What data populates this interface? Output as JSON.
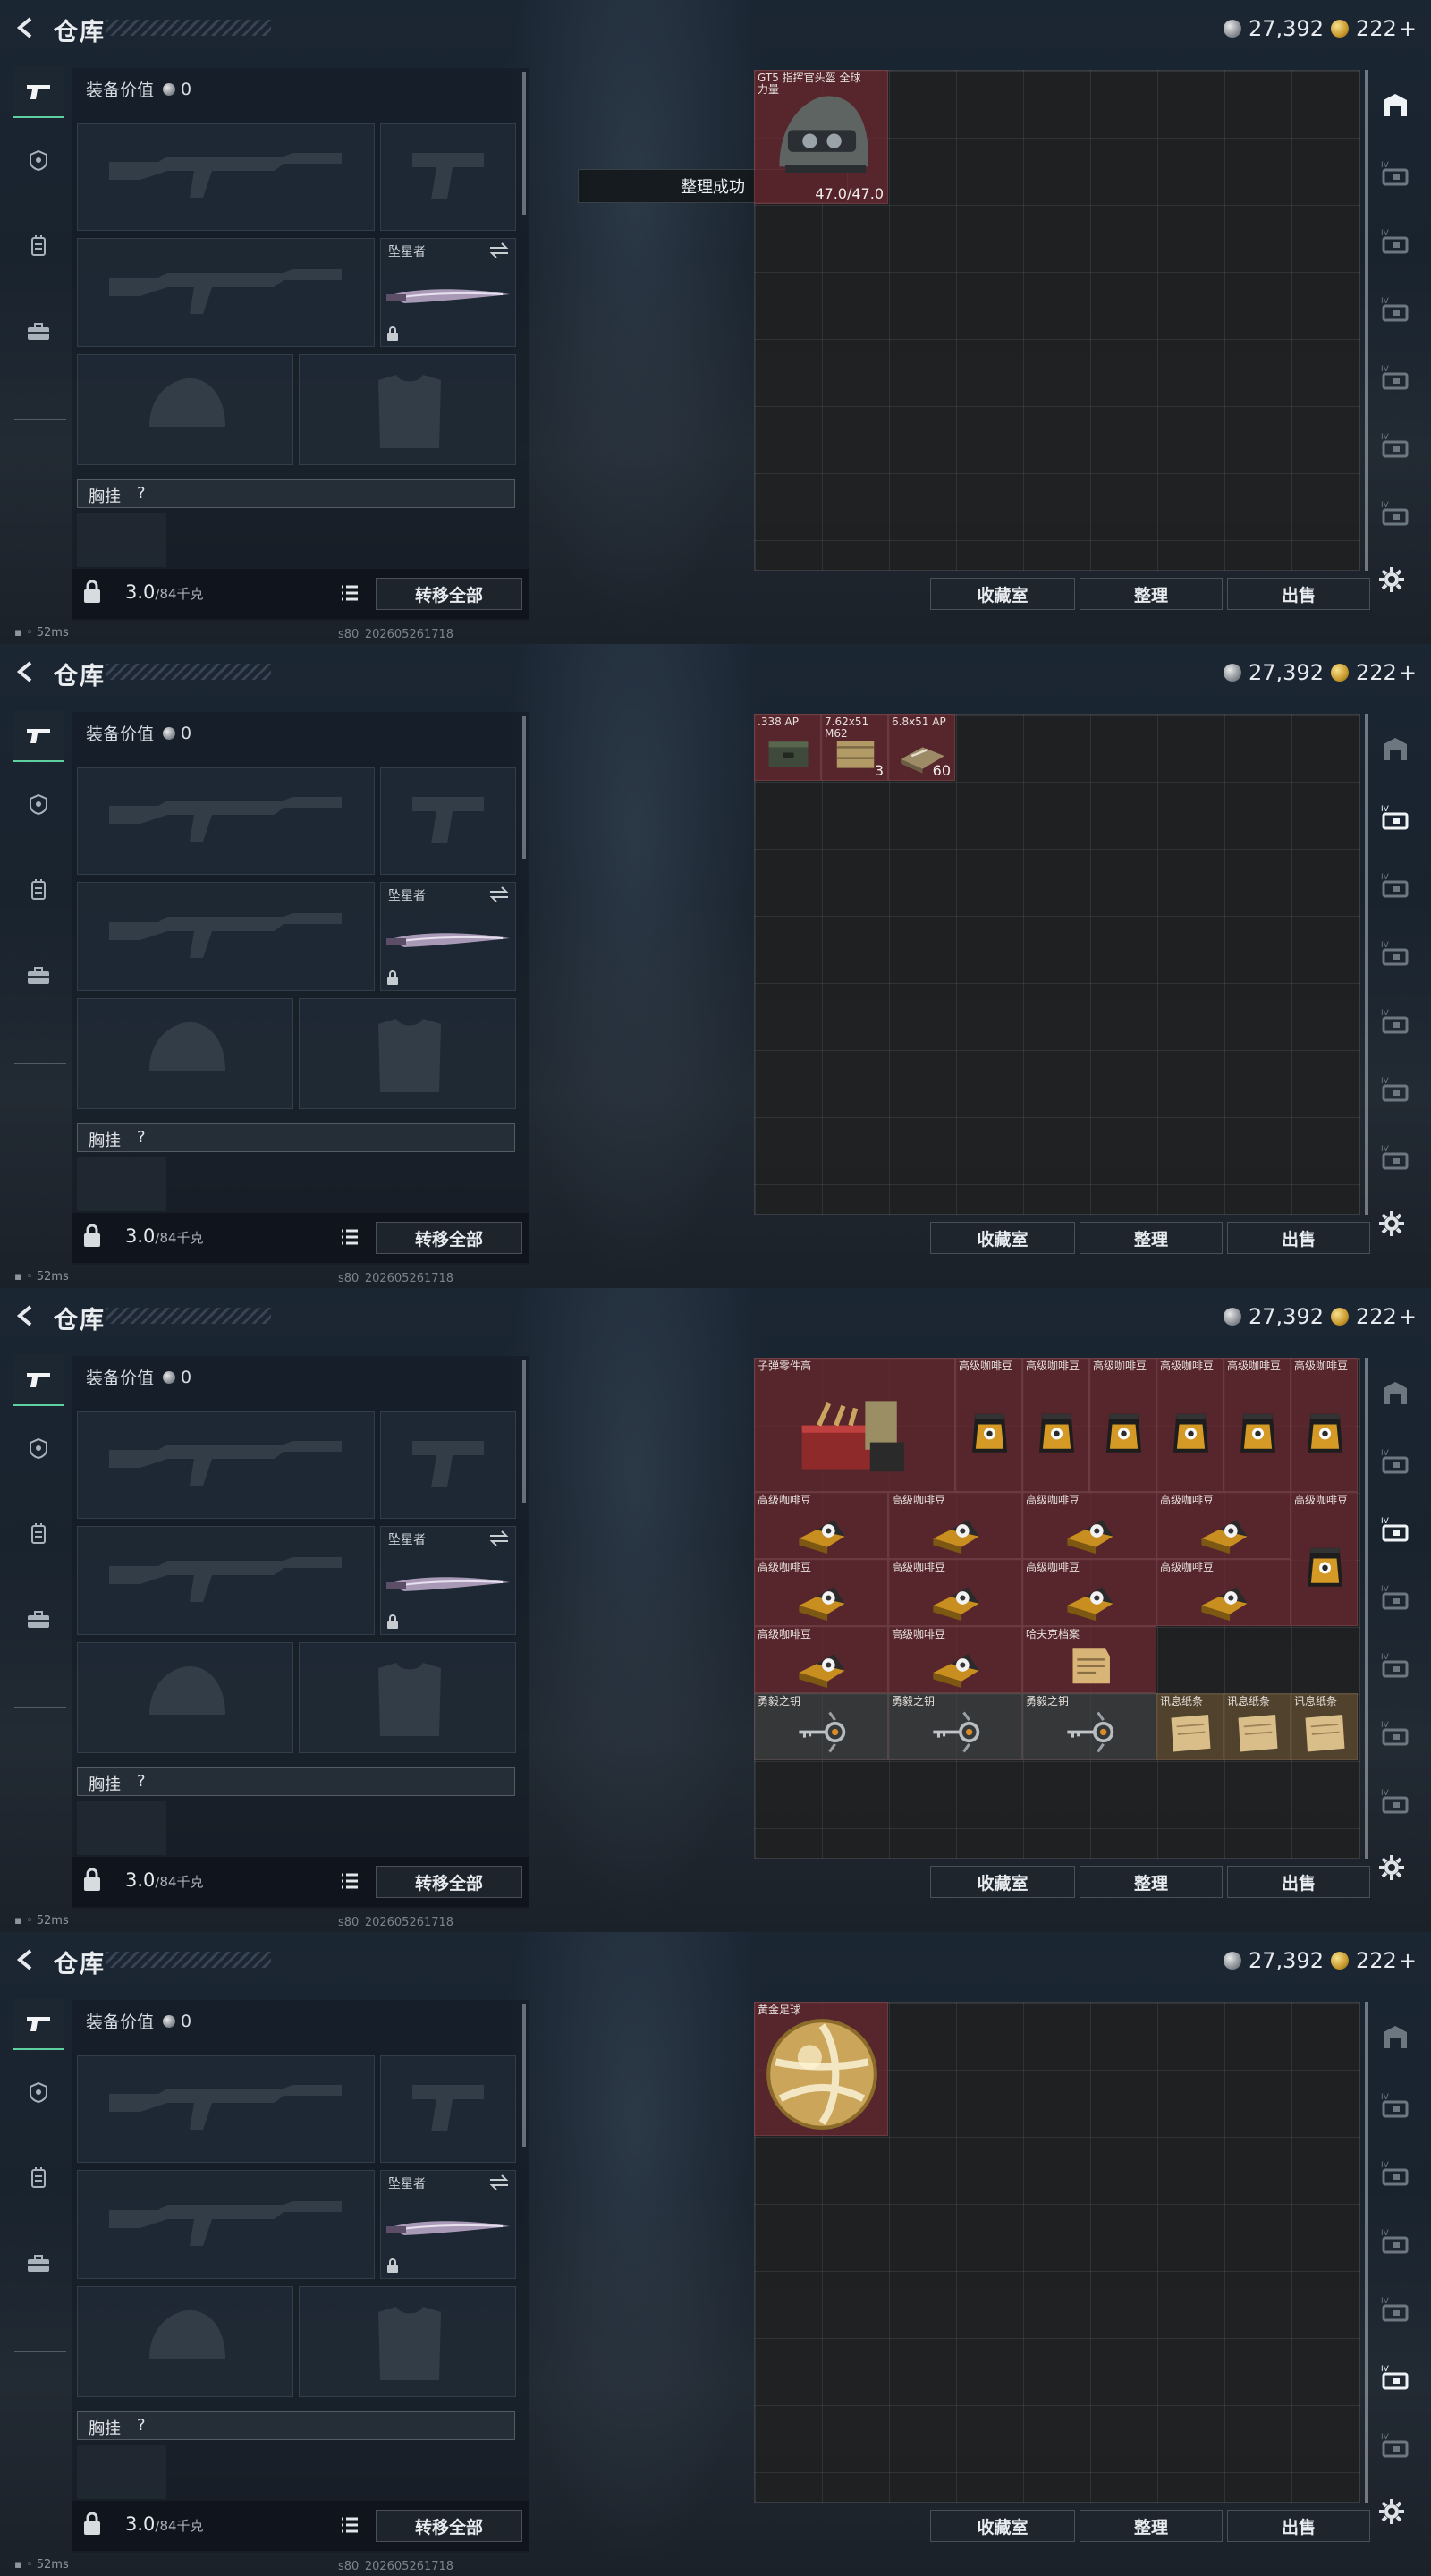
{
  "header": {
    "title": "仓库",
    "silver": "27,392",
    "gold": "222",
    "gold_plus": "+"
  },
  "loadout": {
    "value_label": "装备价值",
    "value": "0",
    "melee_name": "坠星者",
    "chest_label": "胸挂",
    "chest_help": "?",
    "weight": "3.0",
    "weight_max": "/84千克",
    "transfer_label": "转移全部"
  },
  "footer": {
    "favorites_label": "收藏室",
    "sort_label": "整理",
    "sell_label": "出售"
  },
  "status": {
    "ping": "52ms",
    "build": "s80_202605261718"
  },
  "frames": [
    {
      "active_tab": 0,
      "toast": "整理成功",
      "items": [
        {
          "name": "GT5 指挥官头盔 全球力量",
          "qty": "47.0/47.0",
          "col": 0,
          "row": 0,
          "w": 2,
          "h": 2,
          "bg": "red",
          "icon": "helmet"
        }
      ]
    },
    {
      "active_tab": 1,
      "toast": "",
      "items": [
        {
          "name": ".338 AP",
          "qty": "",
          "col": 0,
          "row": 0,
          "w": 1,
          "h": 1,
          "bg": "red",
          "icon": "ammo-box"
        },
        {
          "name": "7.62x51 M62",
          "qty": "3",
          "col": 1,
          "row": 0,
          "w": 1,
          "h": 1,
          "bg": "red",
          "icon": "ammo-crate"
        },
        {
          "name": "6.8x51 AP",
          "qty": "60",
          "col": 2,
          "row": 0,
          "w": 1,
          "h": 1,
          "bg": "red",
          "icon": "ammo-pack"
        }
      ]
    },
    {
      "active_tab": 2,
      "toast": "",
      "items": [
        {
          "name": "子弹零件高",
          "qty": "",
          "col": 0,
          "row": 0,
          "w": 3,
          "h": 2,
          "bg": "red",
          "icon": "parts"
        },
        {
          "name": "高级咖啡豆",
          "qty": "",
          "col": 3,
          "row": 0,
          "w": 1,
          "h": 2,
          "bg": "red",
          "icon": "coffee-bag"
        },
        {
          "name": "高级咖啡豆",
          "qty": "",
          "col": 4,
          "row": 0,
          "w": 1,
          "h": 2,
          "bg": "red",
          "icon": "coffee-bag"
        },
        {
          "name": "高级咖啡豆",
          "qty": "",
          "col": 5,
          "row": 0,
          "w": 1,
          "h": 2,
          "bg": "red",
          "icon": "coffee-bag"
        },
        {
          "name": "高级咖啡豆",
          "qty": "",
          "col": 6,
          "row": 0,
          "w": 1,
          "h": 2,
          "bg": "red",
          "icon": "coffee-bag"
        },
        {
          "name": "高级咖啡豆",
          "qty": "",
          "col": 7,
          "row": 0,
          "w": 1,
          "h": 2,
          "bg": "red",
          "icon": "coffee-bag"
        },
        {
          "name": "高级咖啡豆",
          "qty": "",
          "col": 8,
          "row": 0,
          "w": 1,
          "h": 2,
          "bg": "red",
          "icon": "coffee-bag"
        },
        {
          "name": "高级咖啡豆",
          "qty": "",
          "col": 0,
          "row": 2,
          "w": 2,
          "h": 1,
          "bg": "red",
          "icon": "coffee-box"
        },
        {
          "name": "高级咖啡豆",
          "qty": "",
          "col": 2,
          "row": 2,
          "w": 2,
          "h": 1,
          "bg": "red",
          "icon": "coffee-box"
        },
        {
          "name": "高级咖啡豆",
          "qty": "",
          "col": 4,
          "row": 2,
          "w": 2,
          "h": 1,
          "bg": "red",
          "icon": "coffee-box"
        },
        {
          "name": "高级咖啡豆",
          "qty": "",
          "col": 6,
          "row": 2,
          "w": 2,
          "h": 1,
          "bg": "red",
          "icon": "coffee-box"
        },
        {
          "name": "高级咖啡豆",
          "qty": "",
          "col": 8,
          "row": 2,
          "w": 1,
          "h": 2,
          "bg": "red",
          "icon": "coffee-bag"
        },
        {
          "name": "高级咖啡豆",
          "qty": "",
          "col": 0,
          "row": 3,
          "w": 2,
          "h": 1,
          "bg": "red",
          "icon": "coffee-box"
        },
        {
          "name": "高级咖啡豆",
          "qty": "",
          "col": 2,
          "row": 3,
          "w": 2,
          "h": 1,
          "bg": "red",
          "icon": "coffee-box"
        },
        {
          "name": "高级咖啡豆",
          "qty": "",
          "col": 4,
          "row": 3,
          "w": 2,
          "h": 1,
          "bg": "red",
          "icon": "coffee-box"
        },
        {
          "name": "高级咖啡豆",
          "qty": "",
          "col": 6,
          "row": 3,
          "w": 2,
          "h": 1,
          "bg": "red",
          "icon": "coffee-box"
        },
        {
          "name": "高级咖啡豆",
          "qty": "",
          "col": 0,
          "row": 4,
          "w": 2,
          "h": 1,
          "bg": "red",
          "icon": "coffee-box"
        },
        {
          "name": "高级咖啡豆",
          "qty": "",
          "col": 2,
          "row": 4,
          "w": 2,
          "h": 1,
          "bg": "red",
          "icon": "coffee-box"
        },
        {
          "name": "哈夫克档案",
          "qty": "",
          "col": 4,
          "row": 4,
          "w": 2,
          "h": 1,
          "bg": "red",
          "icon": "document"
        },
        {
          "name": "勇毅之钥",
          "qty": "",
          "col": 0,
          "row": 5,
          "w": 2,
          "h": 1,
          "bg": "dark",
          "icon": "key"
        },
        {
          "name": "勇毅之钥",
          "qty": "",
          "col": 2,
          "row": 5,
          "w": 2,
          "h": 1,
          "bg": "dark",
          "icon": "key"
        },
        {
          "name": "勇毅之钥",
          "qty": "",
          "col": 4,
          "row": 5,
          "w": 2,
          "h": 1,
          "bg": "dark",
          "icon": "key"
        },
        {
          "name": "讯息纸条",
          "qty": "",
          "col": 6,
          "row": 5,
          "w": 1,
          "h": 1,
          "bg": "gold",
          "icon": "note"
        },
        {
          "name": "讯息纸条",
          "qty": "",
          "col": 7,
          "row": 5,
          "w": 1,
          "h": 1,
          "bg": "gold",
          "icon": "note"
        },
        {
          "name": "讯息纸条",
          "qty": "",
          "col": 8,
          "row": 5,
          "w": 1,
          "h": 1,
          "bg": "gold",
          "icon": "note"
        }
      ]
    },
    {
      "active_tab": 5,
      "toast": "",
      "items": [
        {
          "name": "黄金足球",
          "qty": "",
          "col": 0,
          "row": 0,
          "w": 2,
          "h": 2,
          "bg": "red",
          "icon": "gold-ball"
        }
      ]
    }
  ],
  "right_tabs": [
    "home-tab",
    "storage-tab-1",
    "storage-tab-2",
    "storage-tab-3",
    "storage-tab-4",
    "storage-tab-5",
    "storage-tab-6"
  ],
  "colors": {
    "active_tab": "#5fd0a0",
    "item_red": "#6e2830",
    "grid_bg": "#202020"
  }
}
